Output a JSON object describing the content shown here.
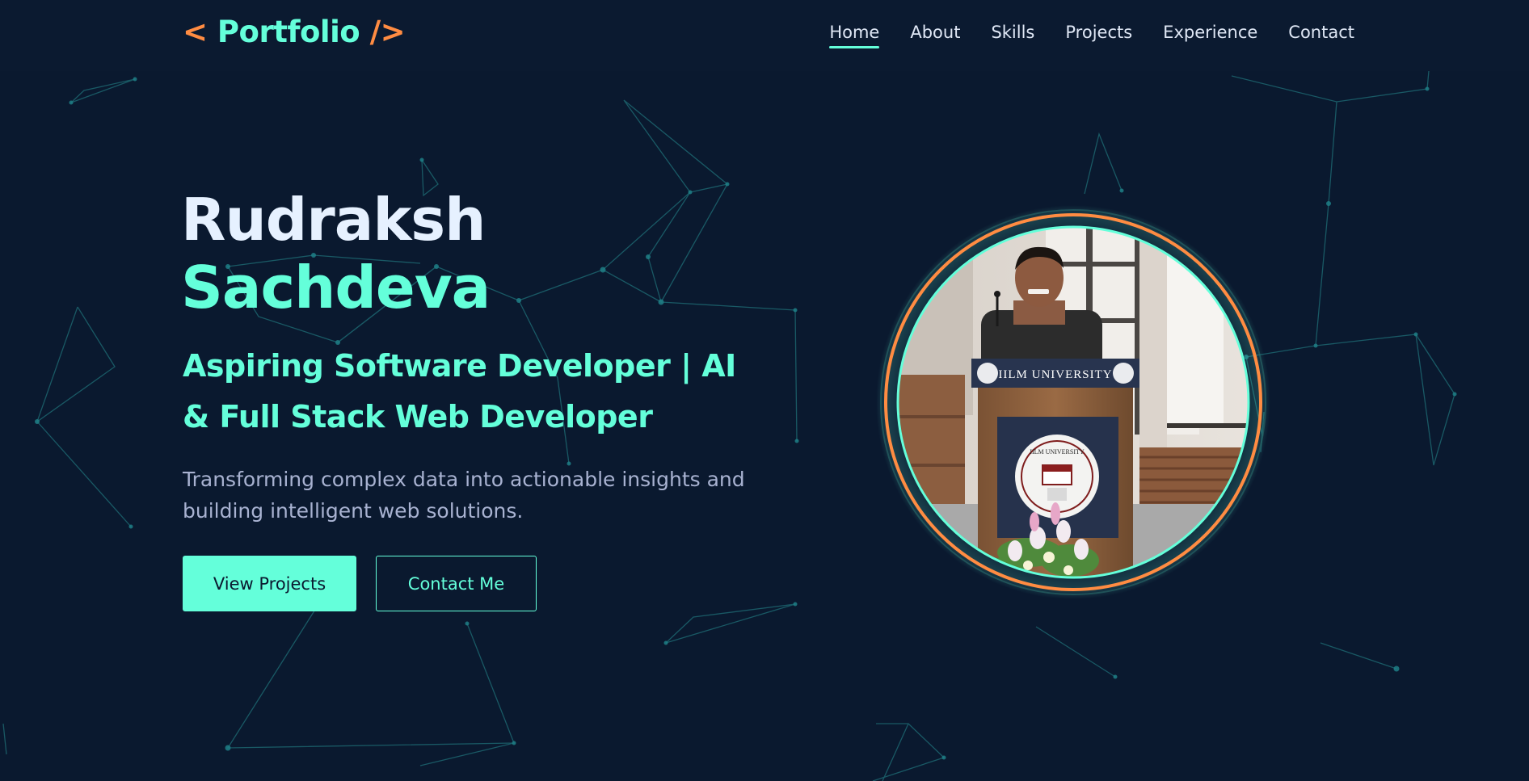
{
  "header": {
    "logo": {
      "open": "<",
      "text": "Portfolio",
      "close": "/>"
    },
    "nav": [
      {
        "label": "Home",
        "active": true
      },
      {
        "label": "About",
        "active": false
      },
      {
        "label": "Skills",
        "active": false
      },
      {
        "label": "Projects",
        "active": false
      },
      {
        "label": "Experience",
        "active": false
      },
      {
        "label": "Contact",
        "active": false
      }
    ]
  },
  "hero": {
    "first_name": "Rudraksh",
    "last_name": "Sachdeva",
    "tagline": "Aspiring Software Developer | AI & Full Stack Web Developer",
    "description": "Transforming complex data into actionable insights and building intelligent web solutions.",
    "primary_button": "View Projects",
    "secondary_button": "Contact Me"
  },
  "photo": {
    "podium_banner": "IILM UNIVERSITY",
    "seal_text": "IILM UNIVERSITY"
  },
  "colors": {
    "background": "#0a192f",
    "accent": "#64ffda",
    "brand_orange": "#ff8c42",
    "heading": "#e6f1ff",
    "body_text": "#a8b2d1"
  }
}
